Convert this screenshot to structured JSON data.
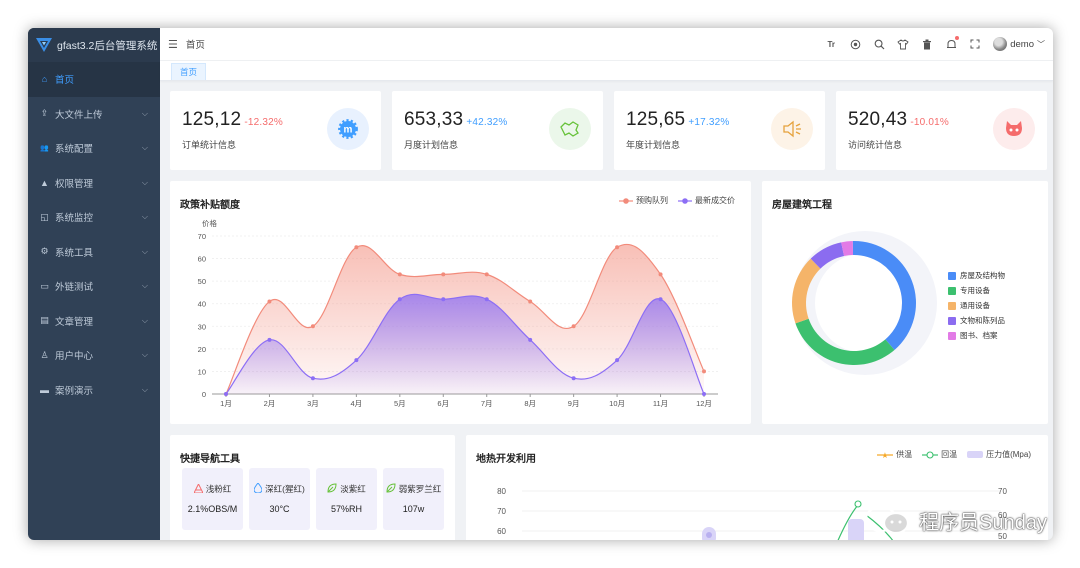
{
  "app": {
    "title": "gfast3.2后台管理系统"
  },
  "sidebar": {
    "items": [
      {
        "label": "首页",
        "icon": "home-icon",
        "active": true
      },
      {
        "label": "大文件上传",
        "icon": "upload-icon"
      },
      {
        "label": "系统配置",
        "icon": "user-group-icon"
      },
      {
        "label": "权限管理",
        "icon": "user-icon"
      },
      {
        "label": "系统监控",
        "icon": "monitor-icon"
      },
      {
        "label": "系统工具",
        "icon": "tool-icon"
      },
      {
        "label": "外链测试",
        "icon": "link-icon"
      },
      {
        "label": "文章管理",
        "icon": "article-icon"
      },
      {
        "label": "用户中心",
        "icon": "person-icon"
      },
      {
        "label": "案例演示",
        "icon": "case-icon"
      }
    ]
  },
  "navbar": {
    "breadcrumb": "首页",
    "user": "demo",
    "font_icon_label": "Tr"
  },
  "tags": {
    "active": "首页"
  },
  "stats": [
    {
      "value": "125,12",
      "pct": "-12.32%",
      "pct_color": "#f56c6c",
      "label": "订单统计信息",
      "icon": "badge-icon",
      "bg": "#e8f1fe",
      "fg": "#409eff"
    },
    {
      "value": "653,33",
      "pct": "+42.32%",
      "pct_color": "#409eff",
      "label": "月度计划信息",
      "icon": "map-icon",
      "bg": "#ebf7ea",
      "fg": "#67c23a"
    },
    {
      "value": "125,65",
      "pct": "+17.32%",
      "pct_color": "#409eff",
      "label": "年度计划信息",
      "icon": "speaker-icon",
      "bg": "#fdf3e7",
      "fg": "#e6a23c"
    },
    {
      "value": "520,43",
      "pct": "-10.01%",
      "pct_color": "#f56c6c",
      "label": "访问统计信息",
      "icon": "github-icon",
      "bg": "#fdecec",
      "fg": "#f56c6c"
    }
  ],
  "policy_card": {
    "title": "政策补贴额度"
  },
  "house_card": {
    "title": "房屋建筑工程"
  },
  "tools_card": {
    "title": "快捷导航工具",
    "items": [
      {
        "name": "浅粉红",
        "value": "2.1%OBS/M",
        "icon": "stack-icon",
        "color": "#f56c6c"
      },
      {
        "name": "深红(猩红)",
        "value": "30°C",
        "icon": "drop-icon",
        "color": "#409eff"
      },
      {
        "name": "淡紫红",
        "value": "57%RH",
        "icon": "leaf-icon",
        "color": "#67c23a"
      },
      {
        "name": "弱紫罗兰红",
        "value": "107w",
        "icon": "leaf-icon",
        "color": "#67c23a"
      }
    ]
  },
  "geo_card": {
    "title": "地热开发利用",
    "legend": [
      "供温",
      "回温",
      "压力值(Mpa)"
    ]
  },
  "watermark": {
    "text": "程序员Sunday"
  },
  "chart_data": [
    {
      "type": "area",
      "title": "政策补贴额度",
      "ylabel": "价格",
      "categories": [
        "1月",
        "2月",
        "3月",
        "4月",
        "5月",
        "6月",
        "7月",
        "8月",
        "9月",
        "10月",
        "11月",
        "12月"
      ],
      "ylim": [
        0,
        70
      ],
      "yticks": [
        0,
        10,
        20,
        30,
        40,
        50,
        60,
        70
      ],
      "legend_position": "top-right",
      "series": [
        {
          "name": "预购队列",
          "color": "#f28b7b",
          "values": [
            0,
            41,
            30,
            65,
            53,
            53,
            53,
            41,
            30,
            65,
            53,
            10
          ]
        },
        {
          "name": "最新成交价",
          "color": "#8c6ef5",
          "values": [
            0,
            24,
            7,
            15,
            42,
            42,
            42,
            24,
            7,
            15,
            42,
            0
          ]
        }
      ]
    },
    {
      "type": "pie",
      "title": "房屋建筑工程",
      "legend_position": "right",
      "series": [
        {
          "name": "房屋及结构物",
          "color": "#4a8cf7",
          "value": 39
        },
        {
          "name": "专用设备",
          "color": "#3cc06f",
          "value": 31
        },
        {
          "name": "通用设备",
          "color": "#f5b469",
          "value": 18
        },
        {
          "name": "文物和陈列品",
          "color": "#8b6cf0",
          "value": 9
        },
        {
          "name": "图书、档案",
          "color": "#e27be6",
          "value": 3
        }
      ]
    },
    {
      "type": "line",
      "title": "地热开发利用",
      "yticks_left": [
        60,
        70,
        80
      ],
      "yticks_right": [
        50,
        60,
        70
      ],
      "series": [
        {
          "name": "供温",
          "color": "#f5a623"
        },
        {
          "name": "回温",
          "color": "#3cc06f"
        },
        {
          "name": "压力值(Mpa)",
          "color": "#c9c3f5"
        }
      ]
    }
  ]
}
